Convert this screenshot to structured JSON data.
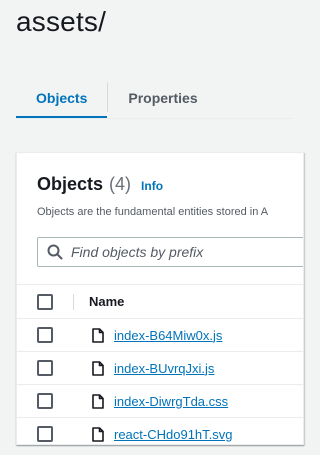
{
  "page": {
    "title": "assets/"
  },
  "tabs": [
    {
      "label": "Objects",
      "active": true
    },
    {
      "label": "Properties",
      "active": false
    }
  ],
  "objects_panel": {
    "title": "Objects",
    "count": "(4)",
    "info_label": "Info",
    "description": "Objects are the fundamental entities stored in A",
    "search": {
      "placeholder": "Find objects by prefix",
      "value": ""
    },
    "table": {
      "columns": [
        "Name"
      ],
      "rows": [
        {
          "name": "index-B64Miw0x.js",
          "icon": "file-icon"
        },
        {
          "name": "index-BUvrqJxi.js",
          "icon": "file-icon"
        },
        {
          "name": "index-DiwrgTda.css",
          "icon": "file-icon"
        },
        {
          "name": "react-CHdo91hT.svg",
          "icon": "file-icon"
        }
      ]
    }
  },
  "colors": {
    "accent": "#0073bb",
    "text": "#16191f",
    "muted": "#545b64",
    "background": "#f2f3f3"
  }
}
